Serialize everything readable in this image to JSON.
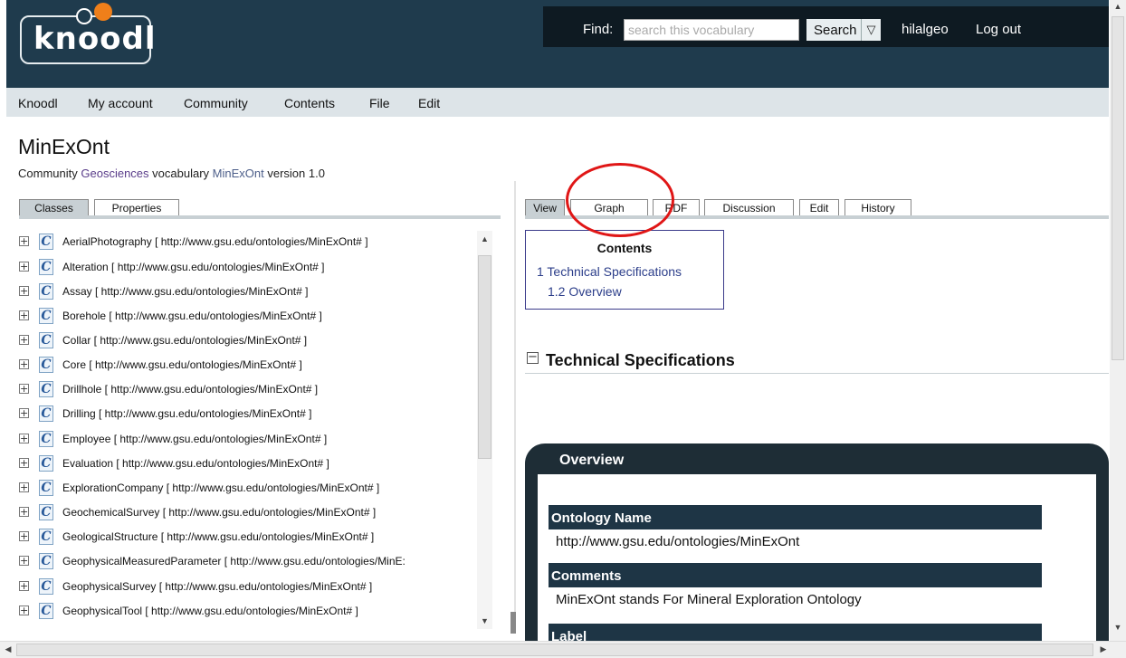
{
  "header": {
    "logo_text": "knoodl",
    "find_label": "Find:",
    "search_placeholder": "search this vocabulary",
    "search_button": "Search",
    "search_dropdown_glyph": "▽",
    "username": "hilalgeo",
    "logout": "Log out"
  },
  "menu": [
    "Knoodl",
    "My account",
    "Community",
    "Contents",
    "File",
    "Edit"
  ],
  "page": {
    "title": "MinExOnt",
    "subtitle_prefix": "Community",
    "community_link": "Geosciences",
    "subtitle_mid": "vocabulary",
    "vocab_link": "MinExOnt",
    "subtitle_suffix": "version 1.0"
  },
  "left_tabs": [
    "Classes",
    "Properties"
  ],
  "classes": [
    "AerialPhotography [ http://www.gsu.edu/ontologies/MinExOnt# ]",
    "Alteration [ http://www.gsu.edu/ontologies/MinExOnt# ]",
    "Assay [ http://www.gsu.edu/ontologies/MinExOnt# ]",
    "Borehole [ http://www.gsu.edu/ontologies/MinExOnt# ]",
    "Collar [ http://www.gsu.edu/ontologies/MinExOnt# ]",
    "Core [ http://www.gsu.edu/ontologies/MinExOnt# ]",
    "Drillhole [ http://www.gsu.edu/ontologies/MinExOnt# ]",
    "Drilling [ http://www.gsu.edu/ontologies/MinExOnt# ]",
    "Employee [ http://www.gsu.edu/ontologies/MinExOnt# ]",
    "Evaluation [ http://www.gsu.edu/ontologies/MinExOnt# ]",
    "ExplorationCompany [ http://www.gsu.edu/ontologies/MinExOnt# ]",
    "GeochemicalSurvey [ http://www.gsu.edu/ontologies/MinExOnt# ]",
    "GeologicalStructure [ http://www.gsu.edu/ontologies/MinExOnt# ]",
    "GeophysicalMeasuredParameter [ http://www.gsu.edu/ontologies/MinE:",
    "GeophysicalSurvey [ http://www.gsu.edu/ontologies/MinExOnt# ]",
    "GeophysicalTool [ http://www.gsu.edu/ontologies/MinExOnt# ]"
  ],
  "class_icon_letter": "C",
  "right_tabs": [
    "View",
    "Graph",
    "RDF",
    "Discussion",
    "Edit",
    "History"
  ],
  "contents": {
    "title": "Contents",
    "items": [
      "1 Technical Specifications",
      "1.2 Overview"
    ]
  },
  "technical_specifications": "Technical Specifications",
  "overview": {
    "title": "Overview",
    "fields": [
      {
        "label": "Ontology Name",
        "value": "http://www.gsu.edu/ontologies/MinExOnt"
      },
      {
        "label": "Comments",
        "value": "MinExOnt stands For Mineral Exploration Ontology"
      },
      {
        "label": "Label",
        "value": ""
      }
    ]
  },
  "colors": {
    "header_bg": "#1f3b4d",
    "topbar_bg": "#0e1a22",
    "logo_accent": "#ef7f1a",
    "annotation_circle": "#e01616"
  }
}
